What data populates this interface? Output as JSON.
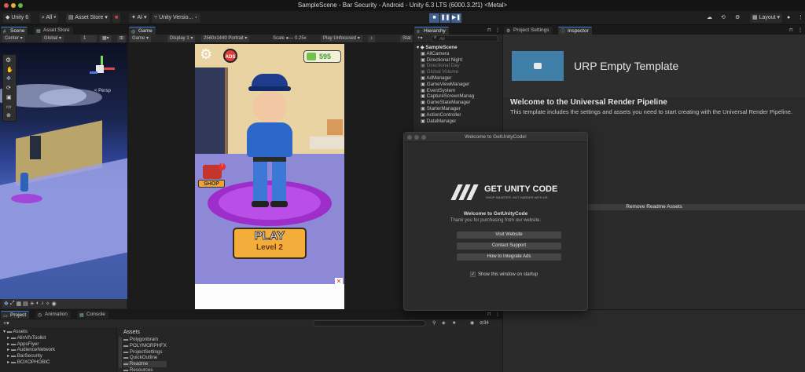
{
  "window_title": "SampleScene - Bar Security - Android - Unity 6.3 LTS (6000.3.2f1) <Metal>",
  "toolbar": {
    "account": "Unity 6",
    "all": "All",
    "asset_store": "Asset Store",
    "ai": "AI",
    "version_control": "Unity Versio...",
    "layout": "Layout"
  },
  "scene_panel": {
    "tabs": [
      "Scene",
      "Asset Store"
    ],
    "pivot": "Center",
    "space": "Global",
    "grid_value": "1",
    "persp_label": "< Persp"
  },
  "game_panel": {
    "tab": "Game",
    "display_mode": "Game",
    "display": "Display 1",
    "resolution": "2560x1440 Portrait",
    "scale_label": "Scale",
    "scale_value": "0.25x",
    "play_focus": "Play Unfocused",
    "stats": "Stat",
    "coins": "595",
    "ads_label": "ADS",
    "shop_label": "SHOP",
    "play_button": "PLAY",
    "level_label": "Level 2"
  },
  "hierarchy": {
    "tab": "Hierarchy",
    "search_placeholder": "All",
    "scene_name": "SampleScene",
    "items": [
      {
        "label": "AllCamera",
        "disabled": false
      },
      {
        "label": "Directional Night",
        "disabled": false
      },
      {
        "label": "Directional Day",
        "disabled": true
      },
      {
        "label": "Global Volume",
        "disabled": true
      },
      {
        "label": "AdManager",
        "disabled": false
      },
      {
        "label": "GameViewManager",
        "disabled": false
      },
      {
        "label": "EventSystem",
        "disabled": false
      },
      {
        "label": "CaptureScreenManag",
        "disabled": false
      },
      {
        "label": "GameStateManager",
        "disabled": false
      },
      {
        "label": "StarterManager",
        "disabled": false
      },
      {
        "label": "ActionController",
        "disabled": false
      },
      {
        "label": "DataManager",
        "disabled": false
      }
    ]
  },
  "inspector": {
    "tabs": [
      "Project Settings",
      "Inspector"
    ],
    "template_title": "URP Empty Template",
    "welcome_heading": "Welcome to the Universal Render Pipeline",
    "welcome_text": "This template includes the settings and assets you need to start creating with the Universal Render Pipeline.",
    "remove_button": "Remove Readme Assets"
  },
  "dialog": {
    "title": "Welcome to GetUnityCode!",
    "logo_text": "GET UNITY CODE",
    "logo_tagline": "SHOP SMARTER. NOT HARDER WITH US.",
    "heading": "Welcome to GetUnityCode",
    "subtext": "Thank you for purchasing from our website.",
    "buttons": [
      "Visit Website",
      "Contact Support",
      "How to Integrate Ads"
    ],
    "checkbox_label": "Show this window on startup",
    "checkbox_checked": true
  },
  "bottom": {
    "tabs": [
      "Project",
      "Animation",
      "Console"
    ],
    "count": "34",
    "left_tree": [
      "Assets",
      "AlinVfxToolkit",
      "AppsFlyer",
      "AudienceNetwork",
      "BarSecurity",
      "BOXOPHOBIC"
    ],
    "assets_header": "Assets",
    "asset_items": [
      "Polygonbrain",
      "POLYMORPHFX",
      "ProjectSettings",
      "QuickOutline",
      "Readme",
      "Resources"
    ]
  }
}
